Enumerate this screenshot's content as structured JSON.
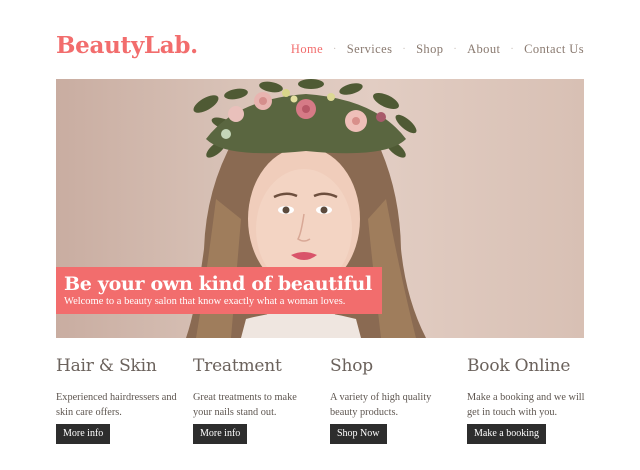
{
  "brand": {
    "name": "BeautyLab.",
    "accent": "#f26d6d"
  },
  "nav": {
    "items": [
      "Home",
      "Services",
      "Shop",
      "About",
      "Contact Us"
    ],
    "active": "Home",
    "separator": "·"
  },
  "hero": {
    "title": "Be your own kind of beautiful",
    "subtitle": "Welcome to a beauty salon that know exactly what a woman loves.",
    "image": "woman-with-flower-crown-photo"
  },
  "features": [
    {
      "title": "Hair & Skin",
      "text": "Experienced hairdressers and skin care offers.",
      "button": "More info"
    },
    {
      "title": "Treatment",
      "text": "Great treatments to make your nails stand out.",
      "button": "More info"
    },
    {
      "title": "Shop",
      "text": "A variety of high quality beauty products.",
      "button": "Shop Now"
    },
    {
      "title": "Book Online",
      "text": "Make a booking and we will get in touch with you.",
      "button": "Make a booking"
    }
  ]
}
